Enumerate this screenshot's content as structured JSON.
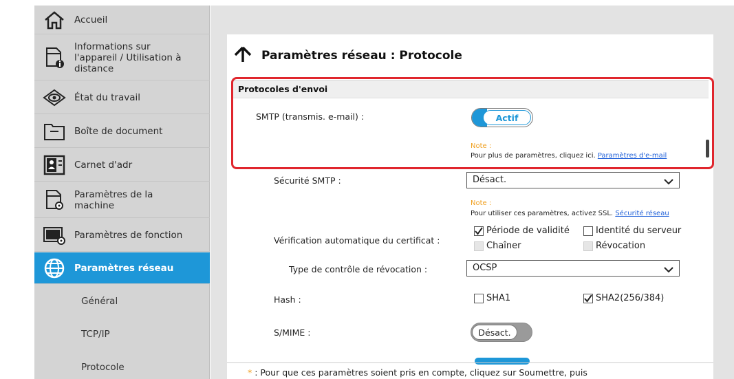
{
  "sidebar": {
    "items": [
      {
        "label": "Accueil",
        "icon": "home-icon"
      },
      {
        "label": "Informations sur l'appareil / Utilisation à distance",
        "icon": "device-info-icon"
      },
      {
        "label": "État du travail",
        "icon": "eye-icon"
      },
      {
        "label": "Boîte de document",
        "icon": "document-box-icon"
      },
      {
        "label": "Carnet d'adr",
        "icon": "address-book-icon"
      },
      {
        "label": "Paramètres de la machine",
        "icon": "machine-settings-icon"
      },
      {
        "label": "Paramètres de fonction",
        "icon": "function-settings-icon"
      },
      {
        "label": "Paramètres réseau",
        "icon": "globe-icon"
      }
    ],
    "sub_items": [
      "Général",
      "TCP/IP",
      "Protocole"
    ]
  },
  "page": {
    "title": "Paramètres réseau : Protocole"
  },
  "section": {
    "title": "Protocoles d'envoi"
  },
  "smtp": {
    "label": "SMTP (transmis. e-mail) :",
    "toggle_label": "Actif",
    "note_title": "Note :",
    "note_text": "Pour plus de paramètres, cliquez ici.",
    "note_link": "Paramètres d'e-mail"
  },
  "smtp_security": {
    "label": "Sécurité SMTP :",
    "value": "Désact.",
    "note_title": "Note :",
    "note_text": "Pour utiliser ces paramètres, activez SSL.",
    "note_link": "Sécurité réseau"
  },
  "cert_check": {
    "label": "Vérification automatique du certificat :",
    "options": [
      {
        "label": "Période de validité",
        "checked": true,
        "disabled": false
      },
      {
        "label": "Identité du serveur",
        "checked": false,
        "disabled": false
      },
      {
        "label": "Chaîner",
        "checked": false,
        "disabled": true
      },
      {
        "label": "Révocation",
        "checked": false,
        "disabled": true
      }
    ]
  },
  "revocation_type": {
    "label": "Type de contrôle de révocation :",
    "value": "OCSP"
  },
  "hash": {
    "label": "Hash :",
    "options": [
      {
        "label": "SHA1",
        "checked": false
      },
      {
        "label": "SHA2(256/384)",
        "checked": true
      }
    ]
  },
  "smime": {
    "label": "S/MIME :",
    "toggle_label": "Désact."
  },
  "footer": {
    "star": "*",
    "text": ": Pour que ces paramètres soient pris en compte, cliquez sur Soumettre, puis"
  },
  "colors": {
    "accent": "#1e97d8",
    "highlight": "#e0262d",
    "note": "#f0a020"
  }
}
